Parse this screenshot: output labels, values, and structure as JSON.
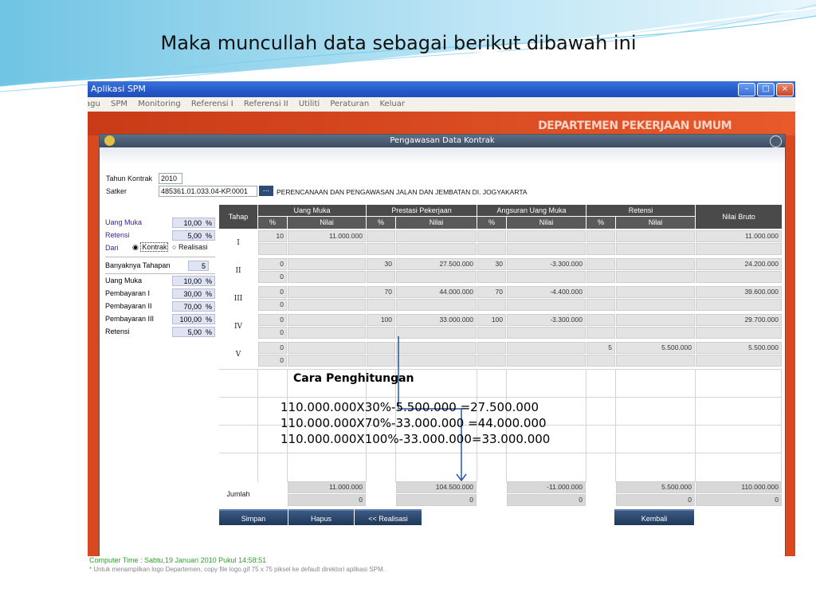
{
  "slide": {
    "title": "Maka muncullah data sebagai berikut dibawah ini"
  },
  "app": {
    "title": "Aplikasi SPM",
    "menu": [
      "agu",
      "SPM",
      "Monitoring",
      "Referensi I",
      "Referensi II",
      "Utiliti",
      "Peraturan",
      "Keluar"
    ],
    "banner": "DEPARTEMEN PEKERJAAN UMUM"
  },
  "dialog": {
    "title": "Pengawasan Data Kontrak",
    "tahun_label": "Tahun Kontrak",
    "tahun_value": "2010",
    "satker_label": "Satker",
    "satker_code": "485361.01.033.04-KP.0001",
    "satker_button": "...",
    "satker_name": "PERENCANAAN DAN PENGAWASAN JALAN DAN JEMBATAN DI. JOGYAKARTA"
  },
  "left": {
    "uang_muka": {
      "label": "Uang Muka",
      "value": "10,00",
      "unit": "%"
    },
    "retensi": {
      "label": "Retensi",
      "value": "5,00",
      "unit": "%"
    },
    "dari_label": "Dari",
    "radio_kontrak": "Kontrak",
    "radio_realisasi": "Realisasi",
    "banyaknya": {
      "label": "Banyaknya Tahapan",
      "value": "5"
    },
    "items": [
      {
        "label": "Uang Muka",
        "value": "10,00",
        "unit": "%"
      },
      {
        "label": "Pembayaran I",
        "value": "30,00",
        "unit": "%"
      },
      {
        "label": "Pembayaran II",
        "value": "70,00",
        "unit": "%"
      },
      {
        "label": "Pembayaran III",
        "value": "100,00",
        "unit": "%"
      },
      {
        "label": "Retensi",
        "value": "5,00",
        "unit": "%"
      }
    ]
  },
  "grid": {
    "headers": {
      "tahap": "Tahap",
      "uang_muka": "Uang Muka",
      "prestasi": "Prestasi Pekerjaan",
      "angsuran": "Angsuran Uang Muka",
      "retensi": "Retensi",
      "bruto": "Nilai Bruto",
      "pct": "%",
      "nilai": "Nilai"
    },
    "rows": [
      {
        "tahap": "I",
        "um_pct": "10",
        "um_nilai": "11.000.000",
        "um_pct2": "",
        "pp_pct": "",
        "pp_nilai": "",
        "au_pct": "",
        "au_nilai": "",
        "rt_pct": "",
        "rt_nilai": "",
        "bruto": "11.000.000"
      },
      {
        "tahap": "II",
        "um_pct": "0",
        "um_nilai": "",
        "um_pct2": "0",
        "pp_pct": "30",
        "pp_nilai": "27.500.000",
        "au_pct": "30",
        "au_nilai": "-3.300.000",
        "rt_pct": "",
        "rt_nilai": "",
        "bruto": "24.200.000"
      },
      {
        "tahap": "III",
        "um_pct": "0",
        "um_nilai": "",
        "um_pct2": "0",
        "pp_pct": "70",
        "pp_nilai": "44.000.000",
        "au_pct": "70",
        "au_nilai": "-4.400.000",
        "rt_pct": "",
        "rt_nilai": "",
        "bruto": "39.600.000"
      },
      {
        "tahap": "IV",
        "um_pct": "0",
        "um_nilai": "",
        "um_pct2": "0",
        "pp_pct": "100",
        "pp_nilai": "33.000.000",
        "au_pct": "100",
        "au_nilai": "-3.300.000",
        "rt_pct": "",
        "rt_nilai": "",
        "bruto": "29.700.000"
      },
      {
        "tahap": "V",
        "um_pct": "0",
        "um_nilai": "",
        "um_pct2": "0",
        "pp_pct": "",
        "pp_nilai": "",
        "au_pct": "",
        "au_nilai": "",
        "rt_pct": "5",
        "rt_nilai": "5.500.000",
        "bruto": "5.500.000"
      }
    ],
    "jumlah": {
      "label": "Jumlah",
      "um": "11.000.000",
      "um2": "0",
      "pp": "104.500.000",
      "pp2": "0",
      "au": "-11.000.000",
      "au2": "0",
      "rt": "5.500.000",
      "rt2": "0",
      "bruto": "110.000.000",
      "bruto2": "0"
    }
  },
  "calc": {
    "title": "Cara Penghitungan",
    "lines": [
      "110.000.000X30%-5.500.000   =27.500.000",
      "110.000.000X70%-33.000.000 =44.000.000",
      "110.000.000X100%-33.000.000=33.000.000"
    ]
  },
  "buttons": {
    "simpan": "Simpan",
    "hapus": "Hapus",
    "realisasi": "<< Realisasi",
    "kembali": "Kembali"
  },
  "status": {
    "line1": "Computer Time : Sabtu,19 Januari 2010 Pukul 14:58:51",
    "line2": "* Untuk menampilkan logo Departemen, copy file logo.gif 75 x 75 piksel ke default direktori aplikasi SPM."
  }
}
